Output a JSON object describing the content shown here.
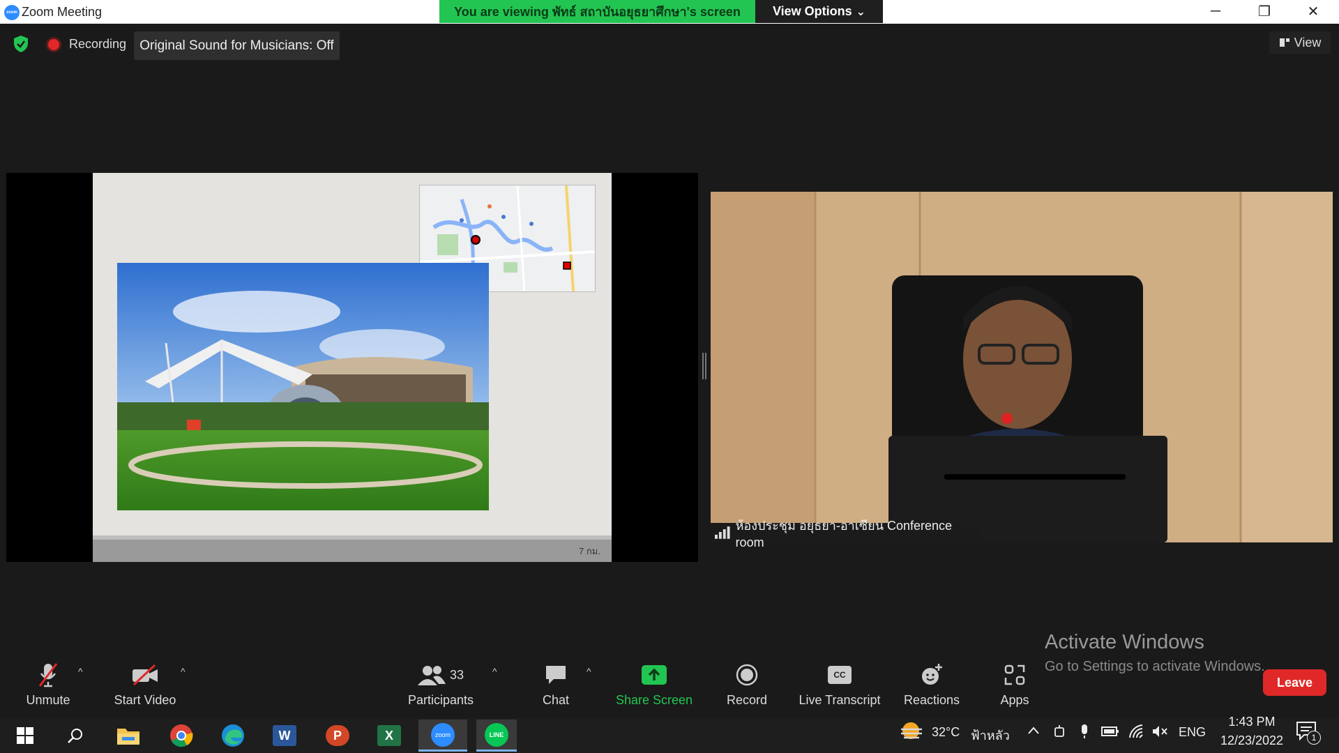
{
  "window": {
    "title": "Zoom Meeting",
    "logo_text": "zoom"
  },
  "banner": {
    "viewing_text": "You are viewing พัทธ์ สถาบันอยุธยาศึกษา's screen",
    "view_options": "View Options",
    "view_options_caret": "⌄"
  },
  "window_controls": {
    "minimize": "─",
    "restore": "❐",
    "close": "✕"
  },
  "status": {
    "recording": "Recording",
    "original_sound": "Original Sound for Musicians: Off",
    "view": "View"
  },
  "slide": {
    "page_label": "7 กม."
  },
  "speaker": {
    "name": "ห้องประชุม อยุธยา-อาเซียน Conference room"
  },
  "activate": {
    "title": "Activate Windows",
    "subtitle": "Go to Settings to activate Windows."
  },
  "toolbar": {
    "unmute": "Unmute",
    "start_video": "Start Video",
    "participants": "Participants",
    "participants_count": "33",
    "chat": "Chat",
    "share_screen": "Share Screen",
    "record": "Record",
    "live_transcript": "Live Transcript",
    "reactions": "Reactions",
    "apps": "Apps",
    "leave": "Leave",
    "caret": "^",
    "cc_glyph": "CC"
  },
  "taskbar": {
    "weather_temp": "32°C",
    "weather_desc": "ฟ้าหลัว",
    "language": "ENG",
    "time": "1:43 PM",
    "date": "12/23/2022",
    "notification_count": "1",
    "app_labels": {
      "word": "W",
      "powerpoint": "P",
      "excel": "X",
      "zoom": "zoom",
      "line": "LINE"
    }
  },
  "colors": {
    "share_green": "#23c552",
    "leave_red": "#e02828",
    "zoom_blue": "#2d8cff"
  }
}
